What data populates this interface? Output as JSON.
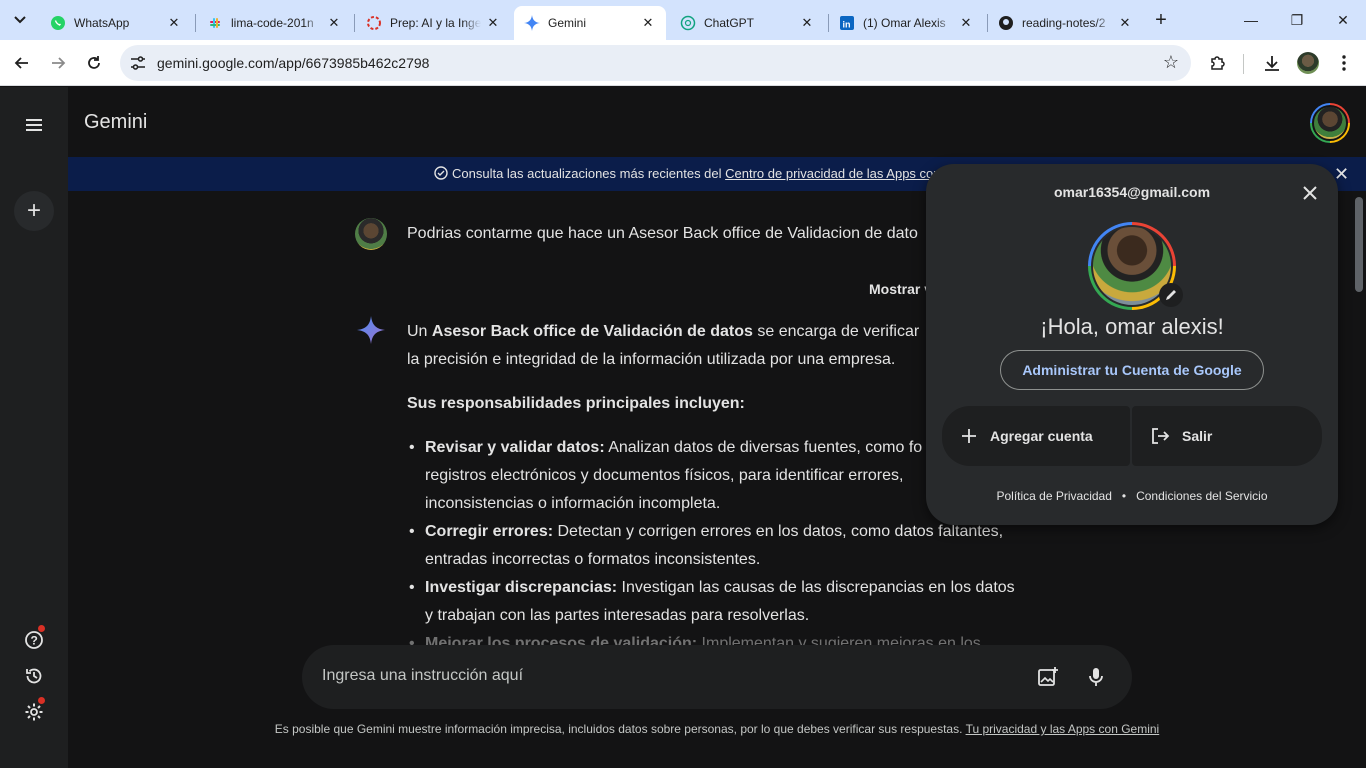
{
  "browser": {
    "tabs": [
      {
        "title": "WhatsApp",
        "active": false
      },
      {
        "title": "lima-code-201n",
        "active": false
      },
      {
        "title": "Prep: AI y la Inge",
        "active": false
      },
      {
        "title": "Gemini",
        "active": true
      },
      {
        "title": "ChatGPT",
        "active": false
      },
      {
        "title": "(1) Omar Alexis",
        "active": false
      },
      {
        "title": "reading-notes/2",
        "active": false
      }
    ],
    "url": "gemini.google.com/app/6673985b462c2798"
  },
  "app": {
    "name": "Gemini",
    "banner": {
      "text": "Consulta las actualizaciones más recientes del ",
      "link": "Centro de privacidad de las Apps con G"
    },
    "user_prompt": "Podrias contarme que hace un Asesor Back office de Validacion de dato",
    "show_drafts": "Mostrar v",
    "response": {
      "intro_1": "Un ",
      "intro_bold": "Asesor Back office de Validación de datos",
      "intro_2": " se encarga de verificar",
      "intro_3": "la precisión e integridad de la información utilizada por una empresa.",
      "heading": "Sus responsabilidades principales incluyen:",
      "items": [
        {
          "title": "Revisar y validar datos:",
          "text": " Analizan datos de diversas fuentes, como fo",
          "cont1": "registros electrónicos y documentos físicos, para identificar errores,",
          "cont2": "inconsistencias o información incompleta."
        },
        {
          "title": "Corregir errores:",
          "text": " Detectan y corrigen errores en los datos, como datos faltantes,",
          "cont1": "entradas incorrectas o formatos inconsistentes."
        },
        {
          "title": "Investigar discrepancias:",
          "text": " Investigan las causas de las discrepancias en los datos",
          "cont1": "y trabajan con las partes interesadas para resolverlas."
        },
        {
          "title": "Mejorar los procesos de validación:",
          "text": " Implementan y sugieren mejoras en los"
        }
      ]
    },
    "composer_placeholder": "Ingresa una instrucción aquí",
    "disclaimer": "Es posible que Gemini muestre información imprecisa, incluidos datos sobre personas, por lo que debes verificar sus respuestas. ",
    "disclaimer_link": "Tu privacidad y las Apps con Gemini"
  },
  "account_popup": {
    "email": "omar16354@gmail.com",
    "greeting": "¡Hola, omar alexis!",
    "manage": "Administrar tu Cuenta de Google",
    "add_account": "Agregar cuenta",
    "sign_out": "Salir",
    "privacy": "Política de Privacidad",
    "terms": "Condiciones del Servicio"
  }
}
